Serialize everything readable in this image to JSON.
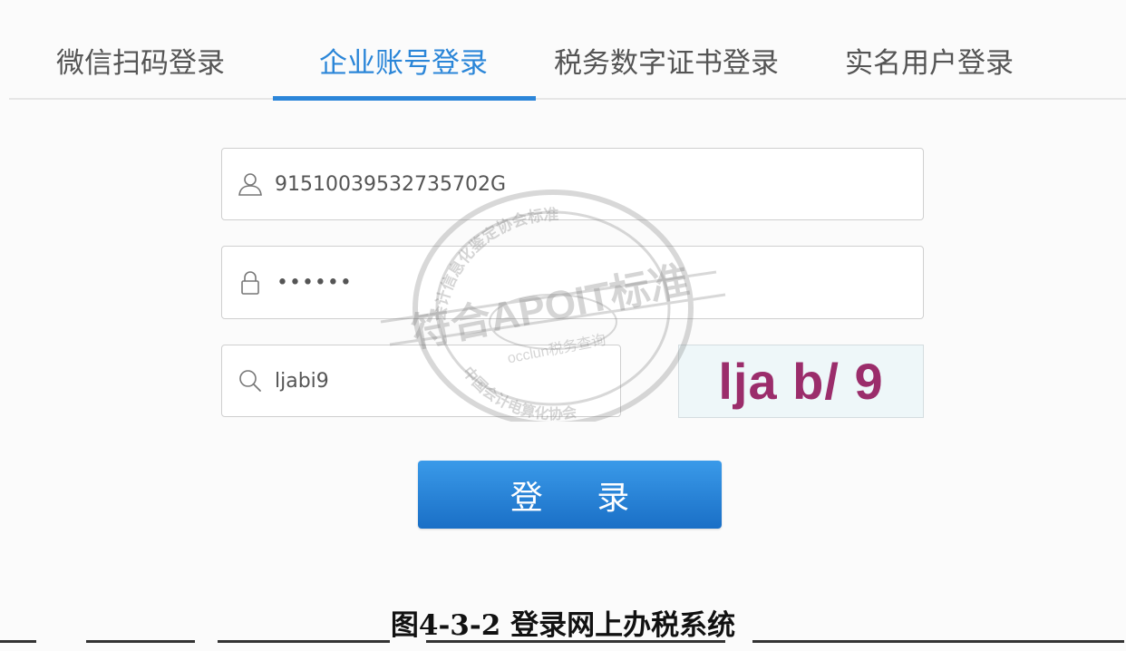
{
  "tabs": [
    {
      "label": "微信扫码登录"
    },
    {
      "label": "企业账号登录"
    },
    {
      "label": "税务数字证书登录"
    },
    {
      "label": "实名用户登录"
    }
  ],
  "active_tab_index": 1,
  "colors": {
    "accent": "#2c86d9",
    "button": "#1f7ad1",
    "captcha_text": "#9b2d6b",
    "captcha_bg": "#eef7f9"
  },
  "form": {
    "account": {
      "icon": "user-icon",
      "value": "91510039532735702G"
    },
    "password": {
      "icon": "lock-icon",
      "masked_value": "••••••"
    },
    "captcha_input": {
      "icon": "search-icon",
      "value": "ljabi9"
    },
    "captcha_image_text": "lja b/ 9",
    "login_label": "登 录"
  },
  "watermark": {
    "main_text": "符合APOIT标准",
    "ring_text_top": "会计信息化鉴定协会标准",
    "ring_text_bottom": "中国会计电算化协会",
    "inner_text": "occlun税务查询"
  },
  "caption": "图4-3-2 登录网上办税系统"
}
